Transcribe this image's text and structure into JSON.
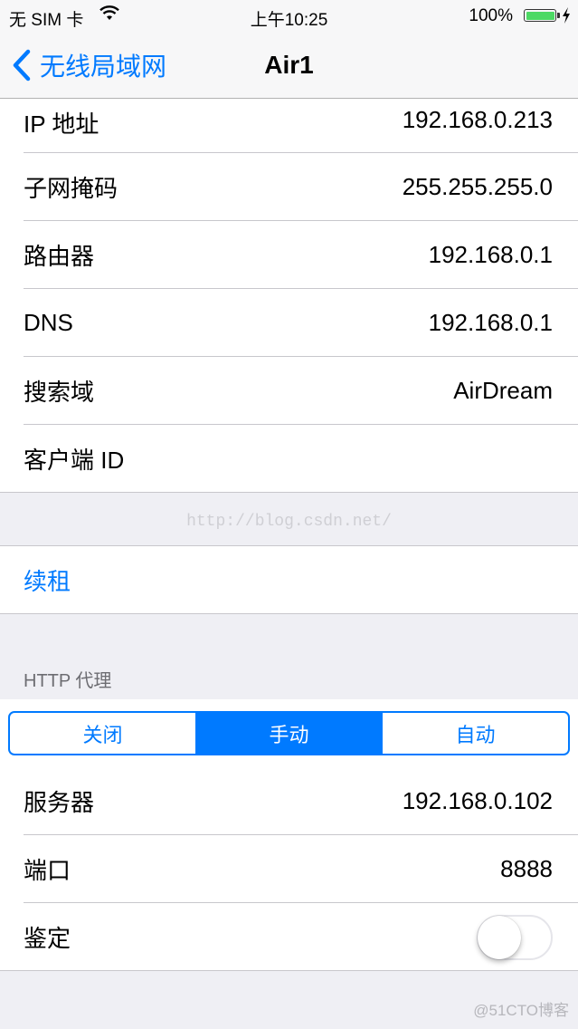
{
  "status_bar": {
    "carrier": "无 SIM 卡",
    "time": "上午10:25",
    "battery_percent": "100%",
    "battery_level": 1.0,
    "charging": true,
    "battery_color": "#4cd964"
  },
  "nav": {
    "back_label": "无线局域网",
    "title": "Air1",
    "accent": "#007aff"
  },
  "ip_info": [
    {
      "label": "IP 地址",
      "value": "192.168.0.213"
    },
    {
      "label": "子网掩码",
      "value": "255.255.255.0"
    },
    {
      "label": "路由器",
      "value": "192.168.0.1"
    },
    {
      "label": "DNS",
      "value": "192.168.0.1"
    },
    {
      "label": "搜索域",
      "value": "AirDream"
    },
    {
      "label": "客户端 ID",
      "value": ""
    }
  ],
  "watermark": "http://blog.csdn.net/",
  "renew": {
    "label": "续租"
  },
  "http_proxy": {
    "header": "HTTP 代理",
    "options": [
      "关闭",
      "手动",
      "自动"
    ],
    "selected": "手动",
    "fields": [
      {
        "label": "服务器",
        "value": "192.168.0.102"
      },
      {
        "label": "端口",
        "value": "8888"
      }
    ],
    "auth": {
      "label": "鉴定",
      "enabled": false
    }
  },
  "corner_brand": "@51CTO博客"
}
